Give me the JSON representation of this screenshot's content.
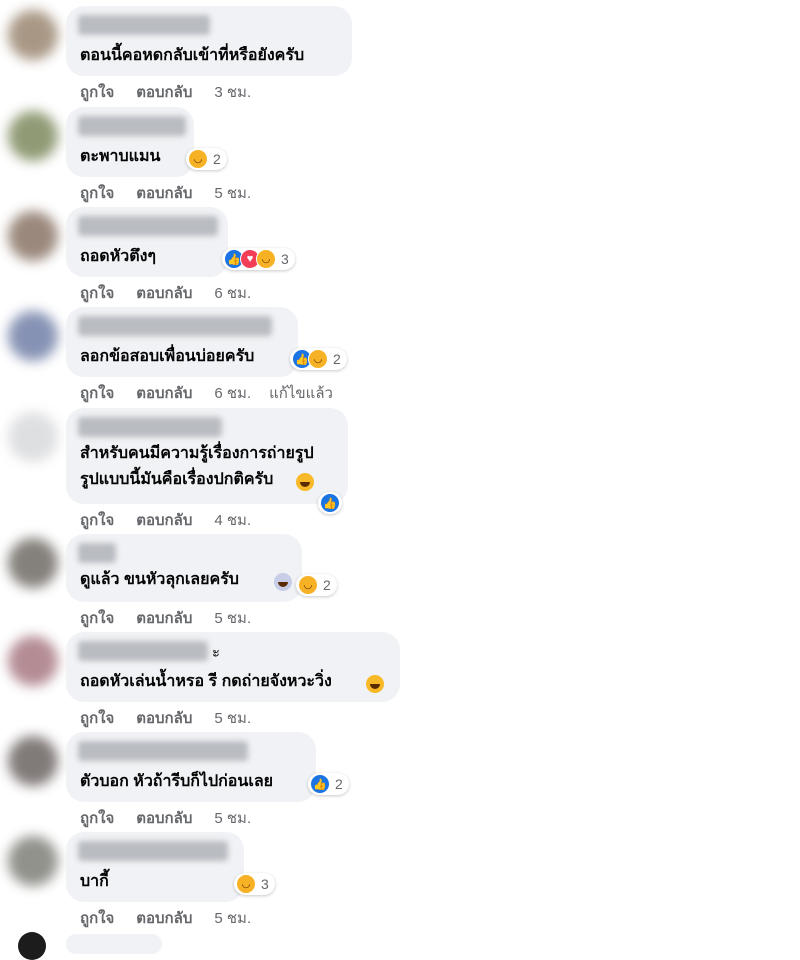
{
  "actions": {
    "like": "ถูกใจ",
    "reply": "ตอบกลับ",
    "edited": "แก้ไขแล้ว"
  },
  "colors": {
    "like": "#1b74e4",
    "love": "#f33e58",
    "haha": "#f7b125",
    "bubble": "#f0f2f5",
    "meta": "#65676b"
  },
  "comments": [
    {
      "text": "ตอนนี้คอหดกลับเข้าที่หรือยังครับ",
      "time": "3 ชม."
    },
    {
      "text": "ตะพาบแมน",
      "time": "5 ชม.",
      "reactions": [
        "haha-icon"
      ],
      "reaction_count": "2"
    },
    {
      "text": "ถอดหัวตึงๆ",
      "time": "6 ชม.",
      "reactions": [
        "like-icon",
        "love-icon",
        "haha-icon"
      ],
      "reaction_count": "3"
    },
    {
      "text": "ลอกข้อสอบเพื่อนบ่อยครับ",
      "time": "6 ชม.",
      "edited": true,
      "reactions": [
        "like-icon",
        "haha-icon"
      ],
      "reaction_count": "2"
    },
    {
      "text_line1": "สำหรับคนมีความรู้เรื่องการถ่ายรูป",
      "text_line2": "รูปแบบนี้มันคือเรื่องปกติครับ",
      "time": "4 ชม.",
      "reactions": [
        "like-icon"
      ]
    },
    {
      "text": "ดูแล้ว ขนหัวลุกเลยครับ",
      "time": "5 ชม.",
      "reactions": [
        "haha-icon"
      ],
      "reaction_count": "2"
    },
    {
      "name_suffix": "ะ",
      "text": "ถอดหัวเล่นน้ำหรอ รี กดถ่ายจังหวะวิ่ง",
      "time": "5 ชม."
    },
    {
      "text": "ตัวบอก หัวถ้ารีบก็ไปก่อนเลย",
      "time": "5 ชม.",
      "reactions": [
        "like-icon"
      ],
      "reaction_count": "2"
    },
    {
      "text": "บากี้",
      "time": "5 ชม.",
      "reactions": [
        "haha-icon"
      ],
      "reaction_count": "3"
    }
  ]
}
